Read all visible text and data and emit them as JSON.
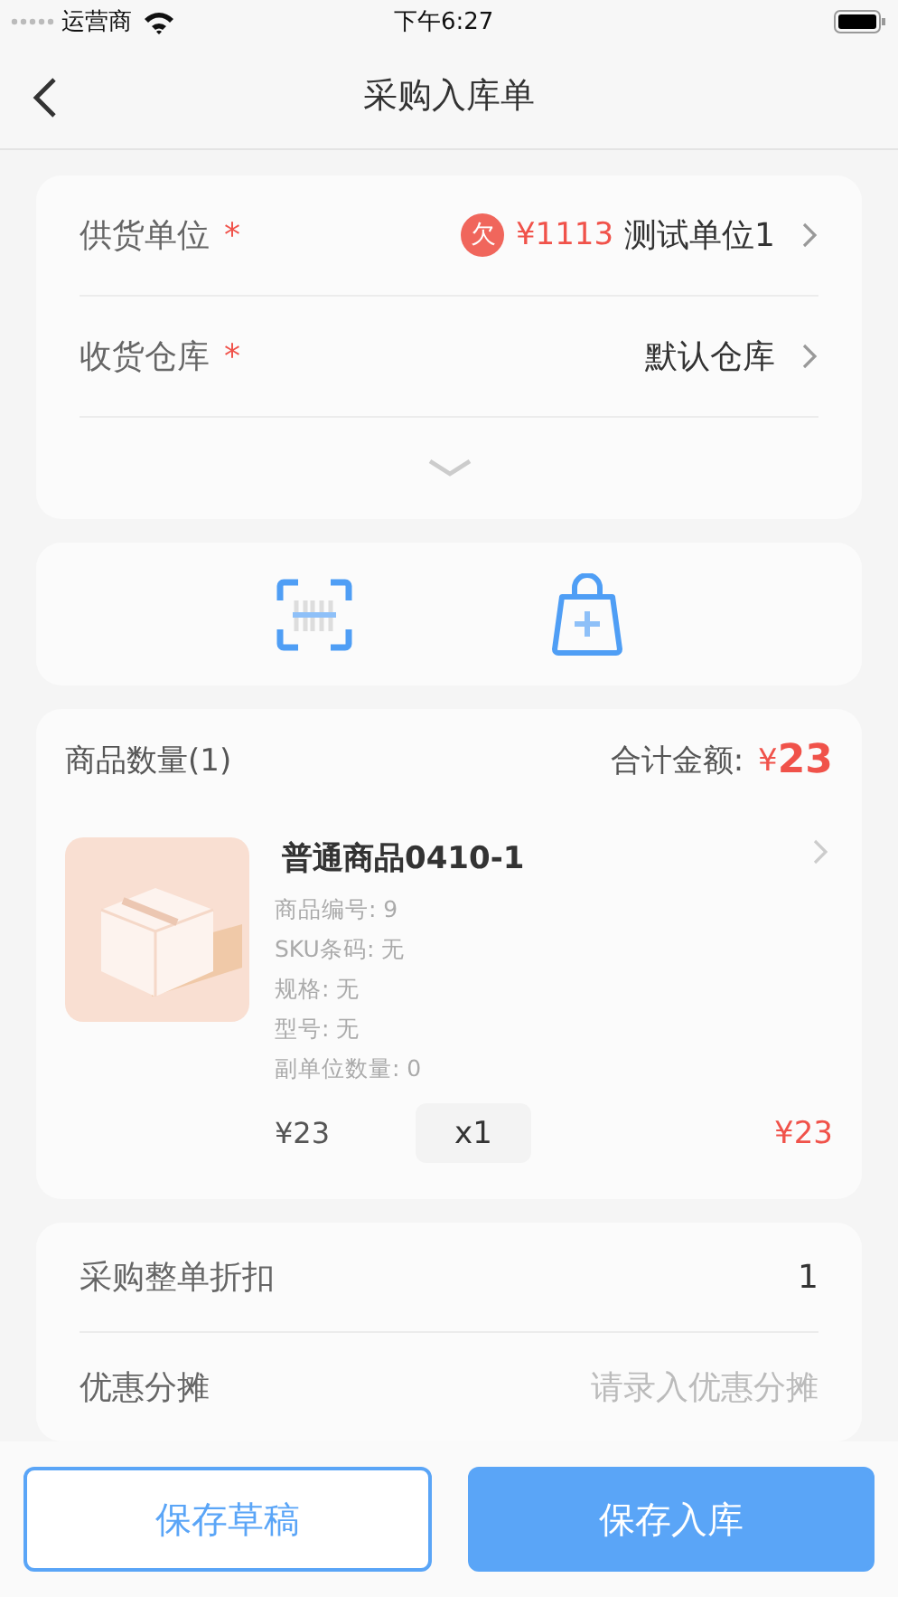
{
  "status_bar": {
    "carrier": "运营商",
    "time": "下午6:27"
  },
  "nav": {
    "title": "采购入库单"
  },
  "header_fields": [
    {
      "label": "供货单位",
      "required": true,
      "badge": "欠",
      "amount": "¥1113",
      "value": "测试单位1"
    },
    {
      "label": "收货仓库",
      "required": true,
      "value": "默认仓库"
    }
  ],
  "required_mark": "*",
  "goods": {
    "count_label": "商品数量(1)",
    "total_label": "合计金额:",
    "total_currency": "¥",
    "total": "23",
    "items": [
      {
        "name": "普通商品0410-1",
        "details": [
          "商品编号:  9",
          "SKU条码:  无",
          "规格:  无",
          "型号:  无",
          "副单位数量:  0"
        ],
        "price": "¥23",
        "qty": "x1",
        "subtotal": "¥23"
      }
    ]
  },
  "summary_rows": [
    {
      "label": "采购整单折扣",
      "value": "1"
    },
    {
      "label": "优惠分摊",
      "placeholder": "请录入优惠分摊"
    }
  ],
  "buttons": [
    {
      "label": "保存草稿",
      "kind": "outline"
    },
    {
      "label": "保存入库",
      "kind": "primary"
    }
  ]
}
